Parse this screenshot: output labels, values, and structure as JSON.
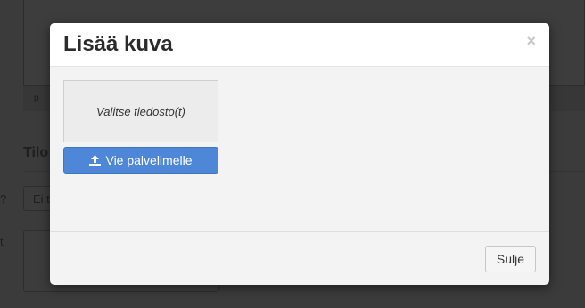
{
  "background": {
    "status_text": "p",
    "heading": "Tilo",
    "select_value": "Ei t",
    "label_question": "?",
    "label_text": "t"
  },
  "modal": {
    "title": "Lisää kuva",
    "close_symbol": "×",
    "dropzone_label": "Valitse tiedosto(t)",
    "upload_button_label": "Vie palvelimelle",
    "upload_icon": "upload-icon",
    "close_button_label": "Sulje",
    "accent_color": "#4e86d8"
  }
}
